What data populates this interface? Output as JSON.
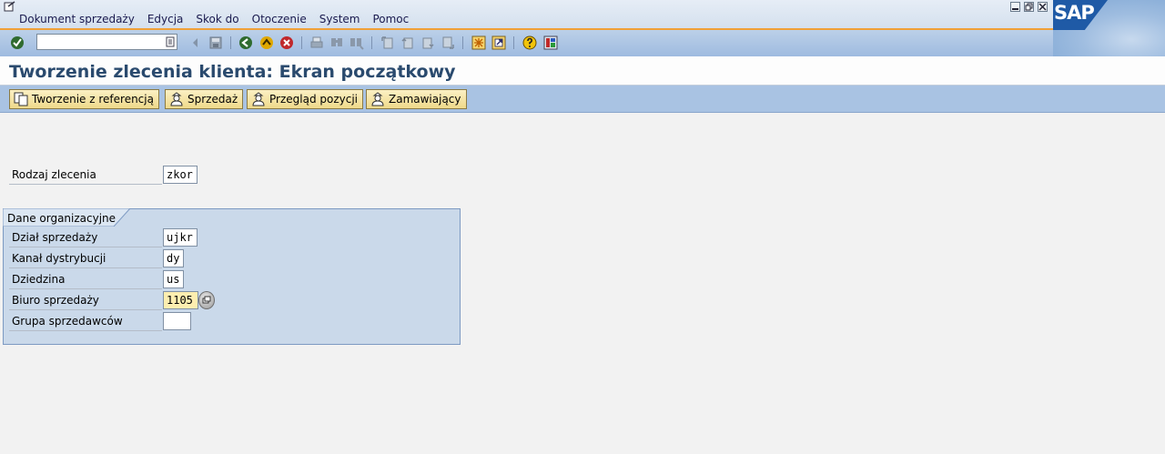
{
  "menu": {
    "items": [
      "Dokument sprzedaży",
      "Edycja",
      "Skok do",
      "Otoczenie",
      "System",
      "Pomoc"
    ]
  },
  "window": {
    "logo_text": "SAP"
  },
  "toolbar": {
    "command_field_value": "",
    "icons": [
      "enter-icon",
      "save-icon",
      "back-icon",
      "exit-icon",
      "cancel-icon",
      "print-icon",
      "find-icon",
      "find-next-icon",
      "first-page-icon",
      "previous-page-icon",
      "next-page-icon",
      "last-page-icon",
      "create-session-icon",
      "shortcut-icon",
      "help-icon",
      "layout-icon"
    ]
  },
  "title": "Tworzenie zlecenia klienta: Ekran początkowy",
  "app_toolbar": {
    "buttons": [
      "Tworzenie z referencją",
      "Sprzedaż",
      "Przegląd pozycji",
      "Zamawiający"
    ]
  },
  "form": {
    "order_type": {
      "label": "Rodzaj zlecenia",
      "value": "zkor"
    },
    "org_group": {
      "title": "Dane organizacyjne",
      "fields": [
        {
          "label": "Dział sprzedaży",
          "value": "ujkr"
        },
        {
          "label": "Kanał dystrybucji",
          "value": "dy"
        },
        {
          "label": "Dziedzina",
          "value": "us"
        },
        {
          "label": "Biuro sprzedaży",
          "value": "1105"
        },
        {
          "label": "Grupa sprzedawców",
          "value": ""
        }
      ]
    }
  }
}
